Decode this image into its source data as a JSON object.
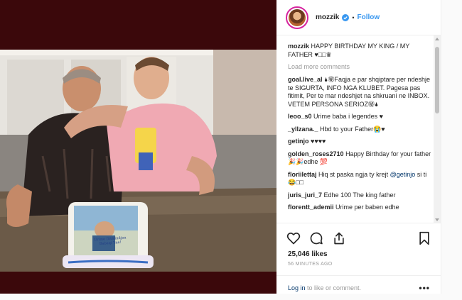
{
  "header": {
    "username": "mozzik",
    "follow_label": "Follow",
    "separator": "•"
  },
  "caption": {
    "username": "mozzik",
    "text": "HAPPY BIRTHDAY MY KING / MY FATHER ♥□□♛"
  },
  "load_more_label": "Load more comments",
  "comments": [
    {
      "user": "goal.live_al",
      "text": "🌢㊙Faqja e par shqiptare per ndeshje te SIGURTA, INFO NGA KLUBET. Pagesa pas fitimit, Per te mar ndeshjet na shkruani ne INBOX. VETEM PERSONA SERIOZ㊙🌢"
    },
    {
      "user": "leoo_s0",
      "text": "Urime baba i legendes ♥"
    },
    {
      "user": "_yllzana._",
      "text": "Hbd to your Father😭♥"
    },
    {
      "user": "getinjo",
      "text": "♥♥♥♥"
    },
    {
      "user": "golden_roses2710",
      "text": "Happy Birthday for your father 🎉🎉edhe 💯"
    },
    {
      "user": "floriilettaj",
      "text": "Hiq st paska ngja ty krejt",
      "mention": "@getinjo",
      "after": " si ti 😂□□"
    },
    {
      "user": "juris_juri_7",
      "text": "Edhe 100 The king father"
    },
    {
      "user": "florentt_ademii",
      "text": "Urime per baben edhe"
    }
  ],
  "likes": "25,046 likes",
  "timestamp": "56 MINUTES AGO",
  "login": {
    "link": "Log in",
    "rest": " to like or comment.",
    "more": "•••"
  },
  "cake": {
    "text_line1": "Urime Ditëlindjen",
    "text_line2": "Babaqi Yne!"
  },
  "colors": {
    "accent": "#3897f0",
    "media_bg": "#3b080b",
    "link": "#003569",
    "muted": "#999999"
  }
}
